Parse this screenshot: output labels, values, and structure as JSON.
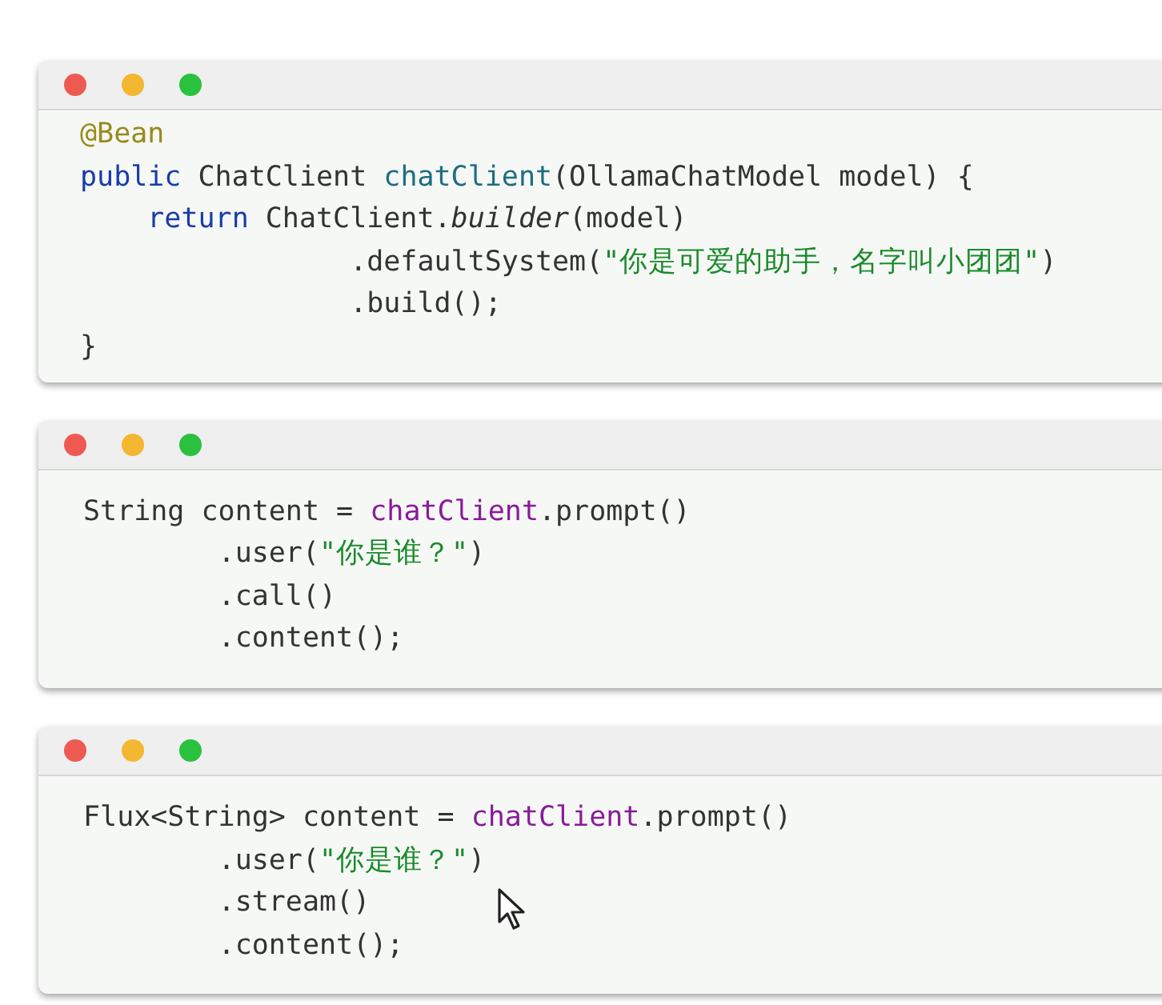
{
  "code_blocks": [
    {
      "lines": [
        [
          {
            "kind": "annotation",
            "text": "@Bean"
          }
        ],
        [
          {
            "kind": "keyword",
            "text": "public"
          },
          {
            "kind": "plain",
            "text": " ChatClient "
          },
          {
            "kind": "method",
            "text": "chatClient"
          },
          {
            "kind": "plain",
            "text": "(OllamaChatModel model) {"
          }
        ],
        [
          {
            "kind": "keyword",
            "text": "    return"
          },
          {
            "kind": "plain",
            "text": " ChatClient."
          },
          {
            "kind": "italic",
            "text": "builder"
          },
          {
            "kind": "plain",
            "text": "(model)"
          }
        ],
        [
          {
            "kind": "plain",
            "text": "                .defaultSystem("
          },
          {
            "kind": "string",
            "text": "\"你是可爱的助手，名字叫小团团\""
          },
          {
            "kind": "plain",
            "text": ")"
          }
        ],
        [
          {
            "kind": "plain",
            "text": "                .build();"
          }
        ],
        [
          {
            "kind": "plain",
            "text": "}"
          }
        ]
      ]
    },
    {
      "lines": [
        [
          {
            "kind": "plain",
            "text": "String content = "
          },
          {
            "kind": "field",
            "text": "chatClient"
          },
          {
            "kind": "plain",
            "text": ".prompt()"
          }
        ],
        [
          {
            "kind": "plain",
            "text": "        .user("
          },
          {
            "kind": "string",
            "text": "\"你是谁？\""
          },
          {
            "kind": "plain",
            "text": ")"
          }
        ],
        [
          {
            "kind": "plain",
            "text": "        .call()"
          }
        ],
        [
          {
            "kind": "plain",
            "text": "        .content();"
          }
        ]
      ]
    },
    {
      "lines": [
        [
          {
            "kind": "plain",
            "text": "Flux<String> content = "
          },
          {
            "kind": "field",
            "text": "chatClient"
          },
          {
            "kind": "plain",
            "text": ".prompt()"
          }
        ],
        [
          {
            "kind": "plain",
            "text": "        .user("
          },
          {
            "kind": "string",
            "text": "\"你是谁？\""
          },
          {
            "kind": "plain",
            "text": ")"
          }
        ],
        [
          {
            "kind": "plain",
            "text": "        .stream()"
          }
        ],
        [
          {
            "kind": "plain",
            "text": "        .content();"
          }
        ]
      ]
    }
  ]
}
